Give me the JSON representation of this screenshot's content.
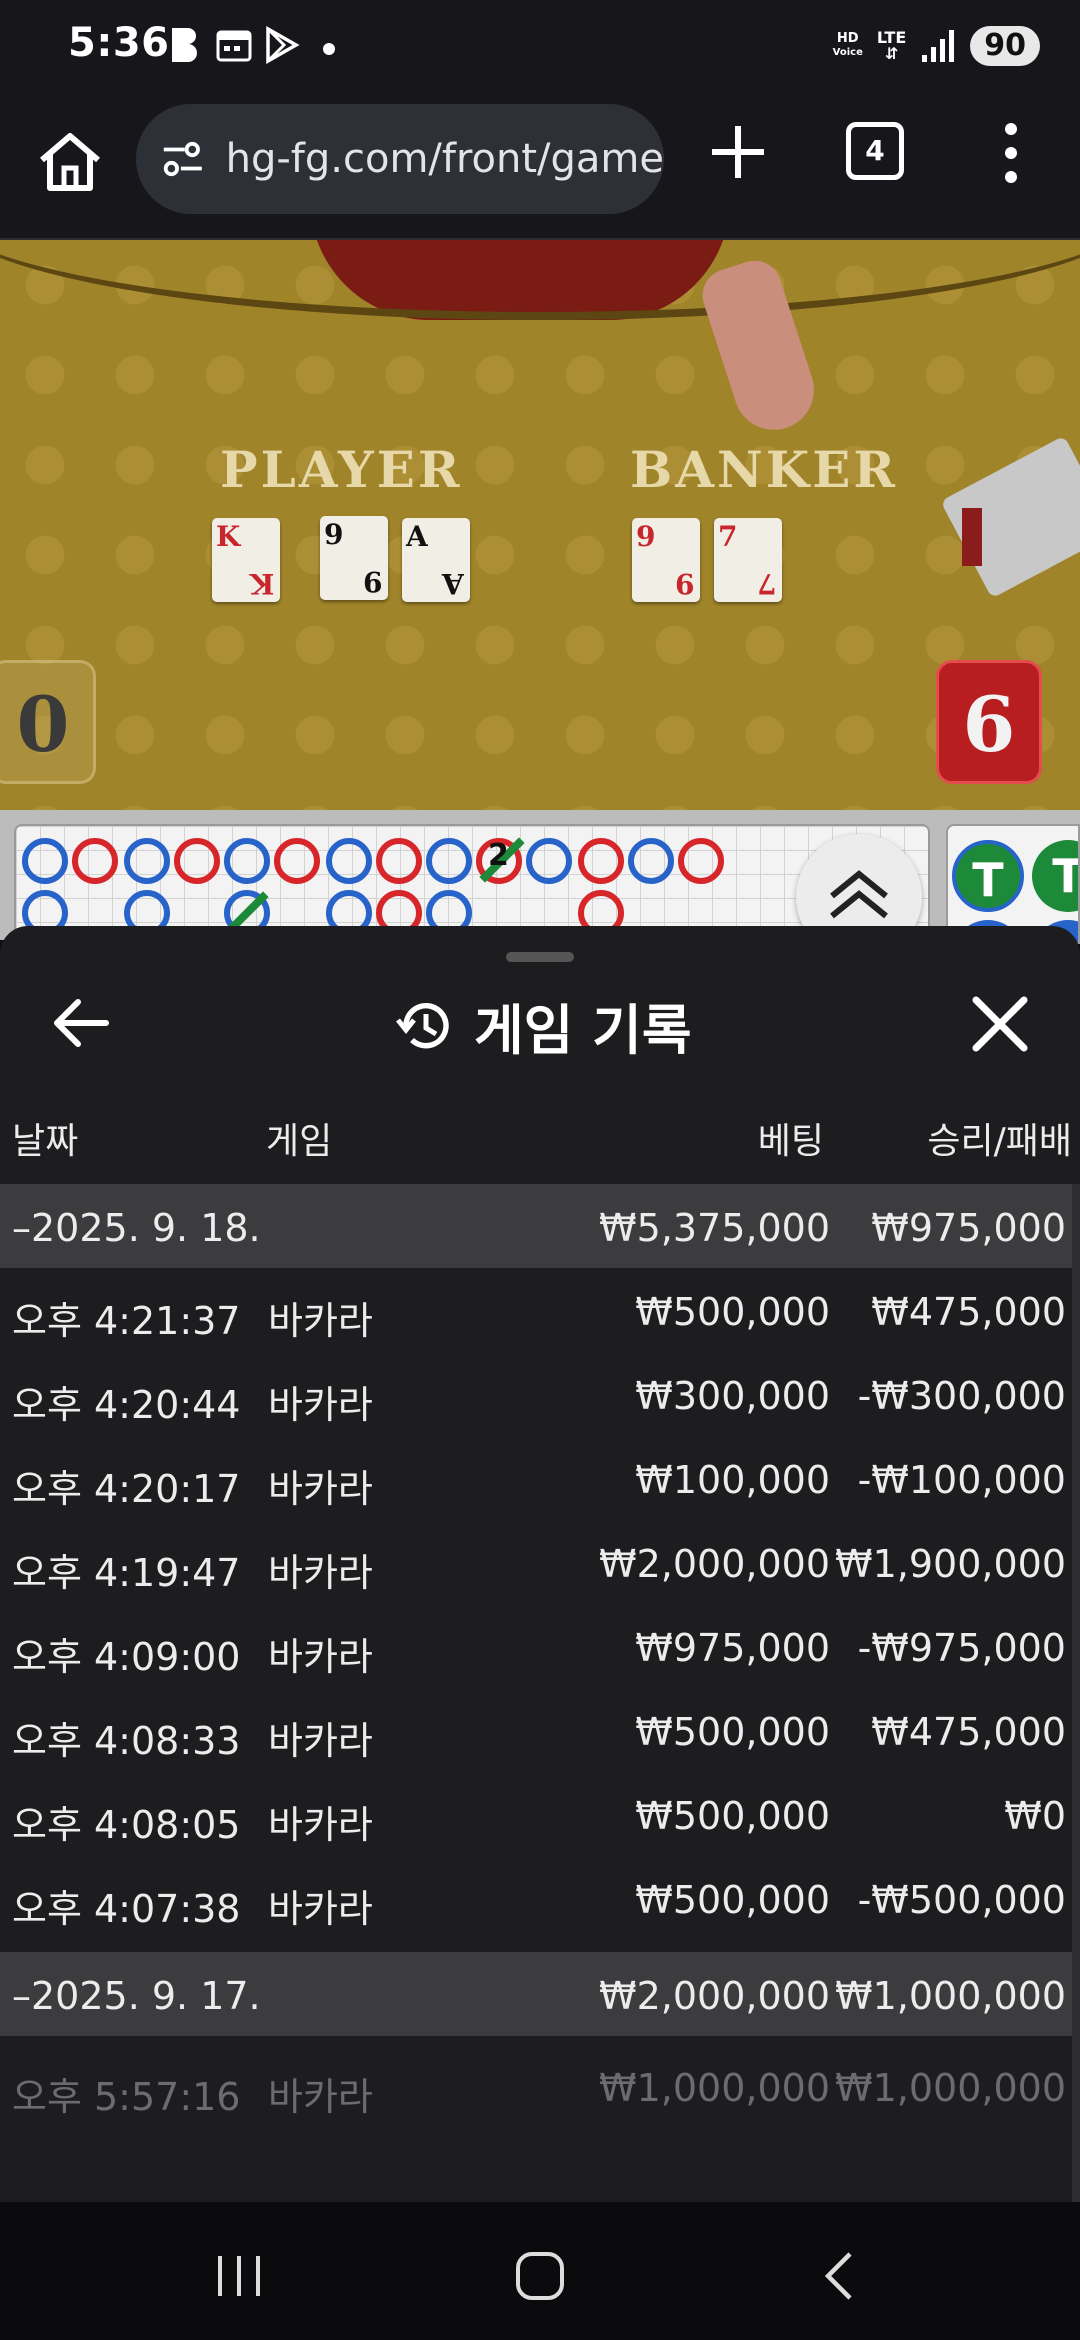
{
  "status_bar": {
    "time": "5:36",
    "hd_voice_top": "HD",
    "hd_voice_bottom": "Voice",
    "lte": "LTE",
    "battery": "90"
  },
  "browser": {
    "url": "hg-fg.com/front/game",
    "tab_count": "4"
  },
  "game": {
    "player_label": "PLAYER",
    "banker_label": "BANKER",
    "player_score": "0",
    "banker_score": "6",
    "player_cards": [
      {
        "rank": "K",
        "suit": "♥",
        "color": "red"
      },
      {
        "rank": "9",
        "suit": "♠",
        "color": "black"
      },
      {
        "rank": "A",
        "suit": "♣",
        "color": "black"
      }
    ],
    "banker_cards": [
      {
        "rank": "9",
        "suit": "♦",
        "color": "red"
      },
      {
        "rank": "7",
        "suit": "♦",
        "color": "red"
      }
    ],
    "road_tie_count": "2",
    "side_road_labels": [
      "T",
      "T"
    ]
  },
  "history": {
    "title": "게임 기록",
    "columns": {
      "date": "날짜",
      "game": "게임",
      "bet": "베팅",
      "result": "승리/패배"
    },
    "groups": [
      {
        "date": "–2025. 9. 18.",
        "total_bet": "₩5,375,000",
        "total_result": "₩975,000",
        "rows": [
          {
            "time": "오후 4:21:37",
            "game": "바카라",
            "bet": "₩500,000",
            "result": "₩475,000"
          },
          {
            "time": "오후 4:20:44",
            "game": "바카라",
            "bet": "₩300,000",
            "result": "-₩300,000"
          },
          {
            "time": "오후 4:20:17",
            "game": "바카라",
            "bet": "₩100,000",
            "result": "-₩100,000"
          },
          {
            "time": "오후 4:19:47",
            "game": "바카라",
            "bet": "₩2,000,000",
            "result": "₩1,900,000"
          },
          {
            "time": "오후 4:09:00",
            "game": "바카라",
            "bet": "₩975,000",
            "result": "-₩975,000"
          },
          {
            "time": "오후 4:08:33",
            "game": "바카라",
            "bet": "₩500,000",
            "result": "₩475,000"
          },
          {
            "time": "오후 4:08:05",
            "game": "바카라",
            "bet": "₩500,000",
            "result": "₩0"
          },
          {
            "time": "오후 4:07:38",
            "game": "바카라",
            "bet": "₩500,000",
            "result": "-₩500,000"
          }
        ]
      },
      {
        "date": "–2025. 9. 17.",
        "total_bet": "₩2,000,000",
        "total_result": "₩1,000,000",
        "rows": [
          {
            "time": "오후 5:57:16",
            "game": "바카라",
            "bet": "₩1,000,000",
            "result": "₩1,000,000"
          }
        ]
      }
    ]
  },
  "colors": {
    "player_blue": "#2763c9",
    "banker_red": "#d6262a",
    "tie_green": "#1d8a3a",
    "sheet_bg": "#1d1d1f",
    "date_row_bg": "#3c3c3e"
  }
}
